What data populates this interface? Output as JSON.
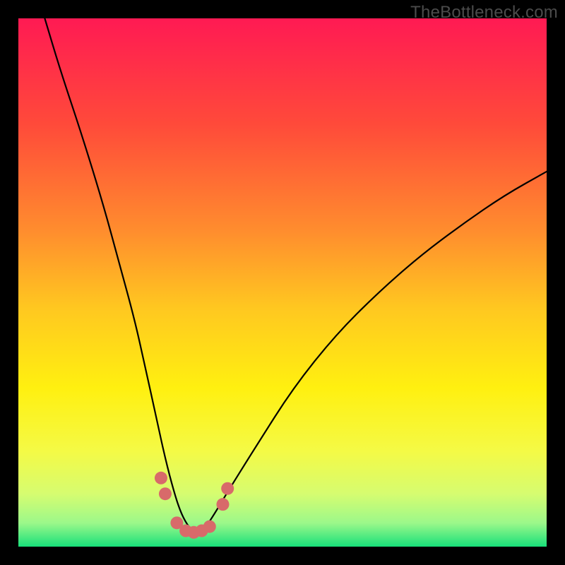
{
  "watermark": "TheBottleneck.com",
  "chart_data": {
    "type": "line",
    "title": "",
    "xlabel": "",
    "ylabel": "",
    "xlim": [
      0,
      100
    ],
    "ylim": [
      0,
      100
    ],
    "grid": false,
    "legend": false,
    "background_gradient": {
      "stops": [
        {
          "offset": 0.0,
          "color": "#ff1a53"
        },
        {
          "offset": 0.2,
          "color": "#ff4a3a"
        },
        {
          "offset": 0.4,
          "color": "#ff8c2e"
        },
        {
          "offset": 0.55,
          "color": "#ffc820"
        },
        {
          "offset": 0.7,
          "color": "#fff010"
        },
        {
          "offset": 0.82,
          "color": "#f4fa46"
        },
        {
          "offset": 0.9,
          "color": "#d6fc70"
        },
        {
          "offset": 0.955,
          "color": "#9cf88a"
        },
        {
          "offset": 1.0,
          "color": "#18e07a"
        }
      ]
    },
    "series": [
      {
        "name": "bottleneck-curve",
        "color": "#000000",
        "x": [
          5,
          8,
          12,
          16,
          19,
          22,
          24,
          26,
          27.5,
          29,
          30.5,
          32,
          33.5,
          35,
          37,
          40,
          45,
          52,
          60,
          68,
          76,
          84,
          92,
          100
        ],
        "y": [
          100,
          90,
          78,
          65,
          54,
          43,
          34,
          25,
          18,
          12,
          7,
          4,
          2.5,
          3,
          6,
          11,
          19,
          30,
          40,
          48,
          55,
          61,
          66.5,
          71
        ]
      }
    ],
    "markers": {
      "name": "highlight-dots",
      "color": "#d86a6a",
      "radius_px": 9,
      "points": [
        {
          "x": 27.0,
          "y": 13.0
        },
        {
          "x": 27.8,
          "y": 10.0
        },
        {
          "x": 30.0,
          "y": 4.5
        },
        {
          "x": 31.7,
          "y": 3.0
        },
        {
          "x": 33.2,
          "y": 2.7
        },
        {
          "x": 34.7,
          "y": 3.0
        },
        {
          "x": 36.2,
          "y": 3.8
        },
        {
          "x": 38.7,
          "y": 8.0
        },
        {
          "x": 39.6,
          "y": 11.0
        }
      ]
    }
  }
}
